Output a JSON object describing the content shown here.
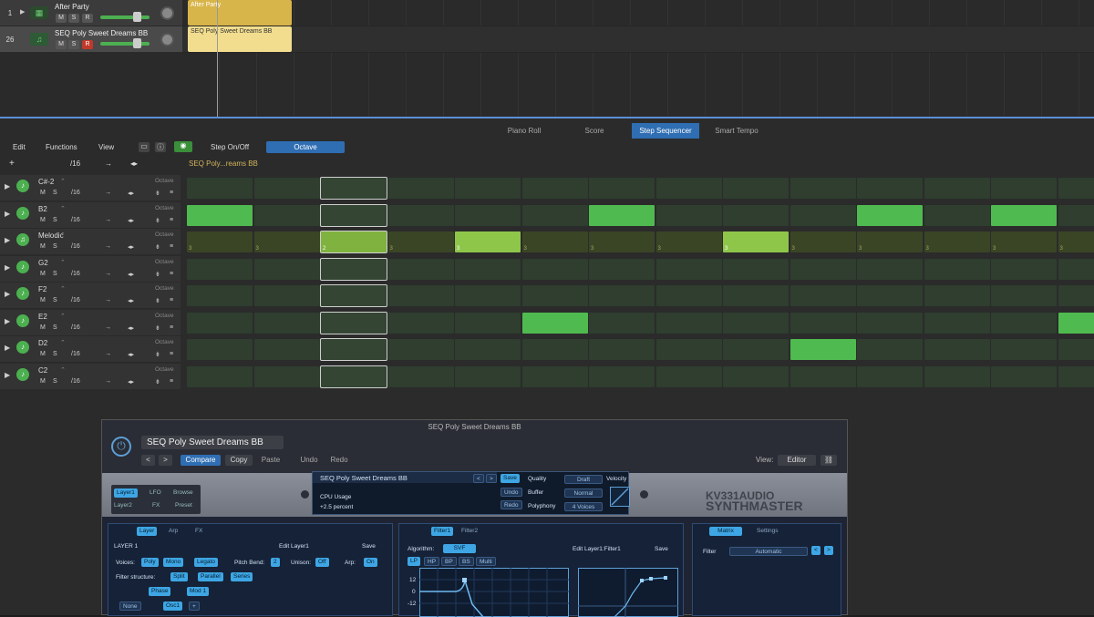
{
  "tracks": [
    {
      "num": "1",
      "name": "After Party",
      "m": "M",
      "s": "S",
      "r": "R",
      "region": "After Party"
    },
    {
      "num": "26",
      "name": "SEQ Poly Sweet Dreams BB",
      "m": "M",
      "s": "S",
      "r": "R",
      "region": "SEQ Poly Sweet Dreams BB"
    }
  ],
  "editor": {
    "tabs": [
      "Piano Roll",
      "Score",
      "Step Sequencer",
      "Smart Tempo"
    ],
    "active_tab": "Step Sequencer",
    "menu": {
      "edit": "Edit",
      "functions": "Functions",
      "view": "View",
      "step": "Step On/Off",
      "octave": "Octave"
    },
    "pattern_length": "/16",
    "region_label": "SEQ Poly...reams BB",
    "rows": [
      {
        "name": "C#-2",
        "oc": "Octave",
        "len": "/16",
        "steps": [],
        "melodic": false
      },
      {
        "name": "B2",
        "oc": "Octave",
        "len": "/16",
        "steps": [
          0,
          6,
          10,
          12
        ],
        "melodic": false
      },
      {
        "name": "Melodic",
        "oc": "Octave",
        "len": "/16",
        "steps": [
          2,
          4,
          8
        ],
        "melodic": true,
        "step_values": {
          "0": "3",
          "1": "3",
          "2": "2",
          "3": "3",
          "4": "3",
          "5": "3",
          "6": "3",
          "7": "3",
          "8": "3",
          "9": "3",
          "10": "3",
          "11": "3",
          "12": "3",
          "13": "3"
        }
      },
      {
        "name": "G2",
        "oc": "Octave",
        "len": "/16",
        "steps": [],
        "melodic": false
      },
      {
        "name": "F2",
        "oc": "Octave",
        "len": "/16",
        "steps": [],
        "melodic": false
      },
      {
        "name": "E2",
        "oc": "Octave",
        "len": "/16",
        "steps": [
          5,
          13
        ],
        "melodic": false
      },
      {
        "name": "D2",
        "oc": "Octave",
        "len": "/16",
        "steps": [
          9
        ],
        "melodic": false
      },
      {
        "name": "C2",
        "oc": "Octave",
        "len": "/16",
        "steps": [],
        "melodic": false
      }
    ]
  },
  "plugin": {
    "window_title": "SEQ Poly Sweet Dreams BB",
    "preset": "SEQ Poly Sweet Dreams BB",
    "compare": "Compare",
    "copy": "Copy",
    "paste": "Paste",
    "undo": "Undo",
    "redo": "Redo",
    "view_label": "View:",
    "view_value": "Editor",
    "layer1": "Layer1",
    "layer2": "Layer2",
    "lfo": "LFO",
    "fx": "FX",
    "browse": "Browse",
    "presetbtn": "Preset",
    "display": {
      "name": "SEQ Poly Sweet Dreams BB",
      "save": "Save",
      "undo": "Undo",
      "redo": "Redo",
      "cpu": "CPU Usage",
      "cpu_val": "+2.5 percent",
      "quality": "Quality",
      "quality_val": "Draft",
      "buffer": "Buffer",
      "buffer_val": "Normal",
      "polyphony": "Polyphony",
      "polyphony_val": "4 Voices",
      "velocity": "Velocity"
    },
    "brand1": "KV331AUDIO",
    "brand2": "SYNTHMASTER",
    "layer_tabs": [
      "Layer",
      "Arp",
      "FX"
    ],
    "layer": {
      "title": "LAYER 1",
      "edit": "Edit Layer1",
      "save": "Save",
      "voices": "Voices:",
      "poly": "Poly",
      "mono": "Mono",
      "legato": "Legato",
      "pitchbend": "Pitch Bend:",
      "pb_val": "2",
      "unison": "Unison:",
      "unison_val": "Off",
      "arp": "Arp:",
      "arp_val": "On",
      "filter_structure": "Filter structure:",
      "split": "Split",
      "parallel": "Parallel",
      "series": "Series",
      "phase": "Phase",
      "mod1": "Mod 1",
      "none": "None",
      "osc1": "Osc1"
    },
    "filter_tabs": [
      "Filter1",
      "Filter2"
    ],
    "filter": {
      "algorithm": "Algorithm:",
      "alg_val": "SVF",
      "edit": "Edit Layer1:Filter1",
      "save": "Save",
      "types": [
        "LP",
        "HP",
        "BP",
        "BS",
        "Multi"
      ],
      "db": [
        "12",
        "0",
        "-12"
      ]
    },
    "matrix_tabs": [
      "Matrix",
      "Settings"
    ],
    "matrix": {
      "filter": "Filter",
      "auto": "Automatic"
    }
  }
}
